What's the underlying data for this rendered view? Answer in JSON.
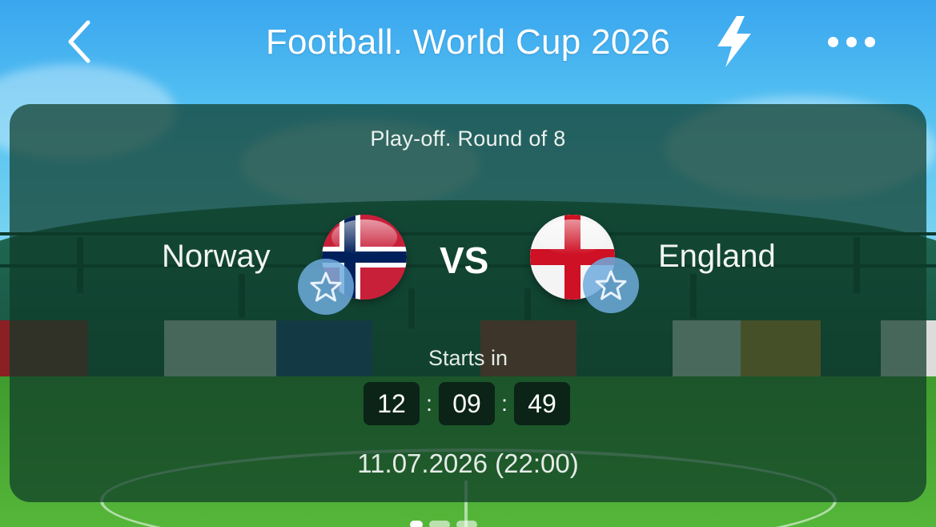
{
  "header": {
    "title": "Football. World Cup 2026",
    "back_icon": "chevron-left-icon",
    "bolt_icon": "lightning-icon",
    "more_icon": "more-horizontal-icon"
  },
  "match": {
    "stage": "Play-off. Round of 8",
    "home": {
      "name": "Norway",
      "flag_icon": "norway-flag-icon",
      "favorite_icon": "star-icon"
    },
    "away": {
      "name": "England",
      "flag_icon": "england-flag-icon",
      "favorite_icon": "star-icon"
    },
    "vs_label": "VS",
    "starts_label": "Starts in",
    "countdown": {
      "hours": "12",
      "separator1": ":",
      "minutes": "09",
      "separator2": ":",
      "seconds": "49"
    },
    "date": "11.07.2026 (22:00)"
  },
  "colors": {
    "card_bg": "#0e3a28",
    "favorite_bg": "#6eaadc",
    "timer_bg": "#0b2417",
    "norway_red": "#c9203a",
    "norway_blue": "#00205b",
    "england_red": "#ce1124"
  }
}
